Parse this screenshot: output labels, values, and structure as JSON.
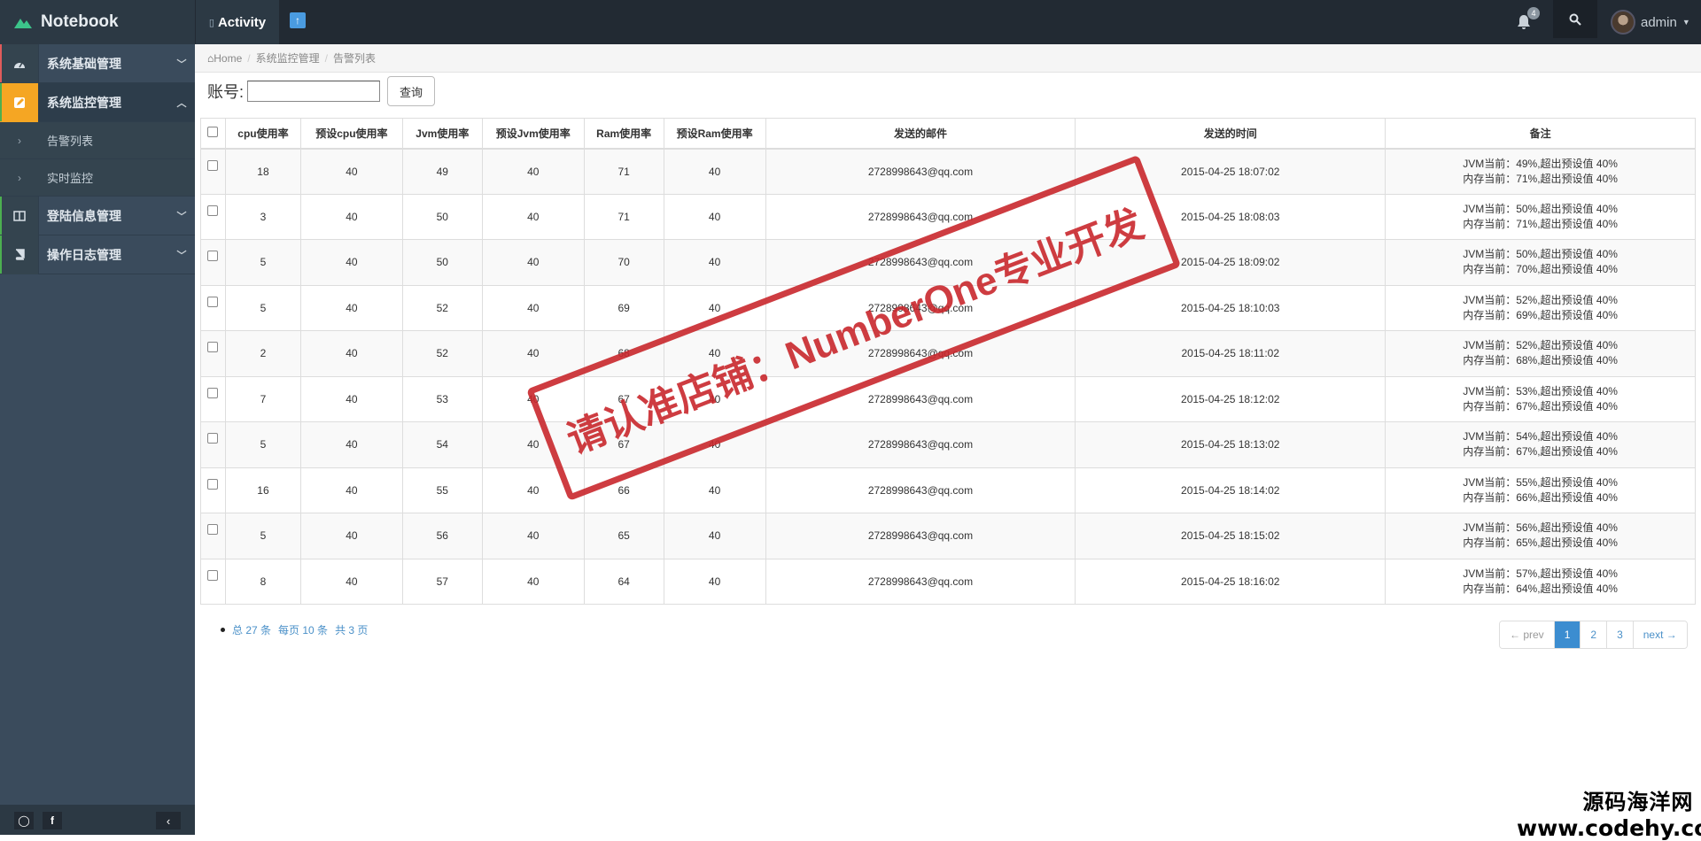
{
  "app": {
    "brand": "Notebook"
  },
  "topnav": {
    "activity_label": "Activity",
    "notification_count": "4",
    "user_name": "admin"
  },
  "sidebar": {
    "items": [
      {
        "label": "系统基础管理",
        "icon": "dashboard-icon"
      },
      {
        "label": "系统监控管理",
        "icon": "edit-icon"
      },
      {
        "label": "告警列表"
      },
      {
        "label": "实时监控"
      },
      {
        "label": "登陆信息管理",
        "icon": "columns-icon"
      },
      {
        "label": "操作日志管理",
        "icon": "book-icon"
      }
    ]
  },
  "breadcrumb": {
    "home": "Home",
    "section": "系统监控管理",
    "page": "告警列表"
  },
  "search": {
    "label": "账号:",
    "value": "",
    "button": "查询"
  },
  "table": {
    "columns": [
      "cpu使用率",
      "预设cpu使用率",
      "Jvm使用率",
      "预设Jvm使用率",
      "Ram使用率",
      "预设Ram使用率",
      "发送的邮件",
      "发送的时间",
      "备注"
    ],
    "rows": [
      {
        "cpu": "18",
        "cpu_set": "40",
        "jvm": "49",
        "jvm_set": "40",
        "ram": "71",
        "ram_set": "40",
        "email": "2728998643@qq.com",
        "time": "2015-04-25 18:07:02",
        "note1": "JVM当前：49%,超出预设值 40%",
        "note2": "内存当前：71%,超出预设值 40%"
      },
      {
        "cpu": "3",
        "cpu_set": "40",
        "jvm": "50",
        "jvm_set": "40",
        "ram": "71",
        "ram_set": "40",
        "email": "2728998643@qq.com",
        "time": "2015-04-25 18:08:03",
        "note1": "JVM当前：50%,超出预设值 40%",
        "note2": "内存当前：71%,超出预设值 40%"
      },
      {
        "cpu": "5",
        "cpu_set": "40",
        "jvm": "50",
        "jvm_set": "40",
        "ram": "70",
        "ram_set": "40",
        "email": "2728998643@qq.com",
        "time": "2015-04-25 18:09:02",
        "note1": "JVM当前：50%,超出预设值 40%",
        "note2": "内存当前：70%,超出预设值 40%"
      },
      {
        "cpu": "5",
        "cpu_set": "40",
        "jvm": "52",
        "jvm_set": "40",
        "ram": "69",
        "ram_set": "40",
        "email": "2728998643@qq.com",
        "time": "2015-04-25 18:10:03",
        "note1": "JVM当前：52%,超出预设值 40%",
        "note2": "内存当前：69%,超出预设值 40%"
      },
      {
        "cpu": "2",
        "cpu_set": "40",
        "jvm": "52",
        "jvm_set": "40",
        "ram": "68",
        "ram_set": "40",
        "email": "2728998643@qq.com",
        "time": "2015-04-25 18:11:02",
        "note1": "JVM当前：52%,超出预设值 40%",
        "note2": "内存当前：68%,超出预设值 40%"
      },
      {
        "cpu": "7",
        "cpu_set": "40",
        "jvm": "53",
        "jvm_set": "40",
        "ram": "67",
        "ram_set": "40",
        "email": "2728998643@qq.com",
        "time": "2015-04-25 18:12:02",
        "note1": "JVM当前：53%,超出预设值 40%",
        "note2": "内存当前：67%,超出预设值 40%"
      },
      {
        "cpu": "5",
        "cpu_set": "40",
        "jvm": "54",
        "jvm_set": "40",
        "ram": "67",
        "ram_set": "40",
        "email": "2728998643@qq.com",
        "time": "2015-04-25 18:13:02",
        "note1": "JVM当前：54%,超出预设值 40%",
        "note2": "内存当前：67%,超出预设值 40%"
      },
      {
        "cpu": "16",
        "cpu_set": "40",
        "jvm": "55",
        "jvm_set": "40",
        "ram": "66",
        "ram_set": "40",
        "email": "2728998643@qq.com",
        "time": "2015-04-25 18:14:02",
        "note1": "JVM当前：55%,超出预设值 40%",
        "note2": "内存当前：66%,超出预设值 40%"
      },
      {
        "cpu": "5",
        "cpu_set": "40",
        "jvm": "56",
        "jvm_set": "40",
        "ram": "65",
        "ram_set": "40",
        "email": "2728998643@qq.com",
        "time": "2015-04-25 18:15:02",
        "note1": "JVM当前：56%,超出预设值 40%",
        "note2": "内存当前：65%,超出预设值 40%"
      },
      {
        "cpu": "8",
        "cpu_set": "40",
        "jvm": "57",
        "jvm_set": "40",
        "ram": "64",
        "ram_set": "40",
        "email": "2728998643@qq.com",
        "time": "2015-04-25 18:16:02",
        "note1": "JVM当前：57%,超出预设值 40%",
        "note2": "内存当前：64%,超出预设值 40%"
      }
    ]
  },
  "summary": {
    "total": "总 27 条",
    "per_page": "每页 10 条",
    "pages": "共 3 页"
  },
  "pagination": {
    "prev": "← prev",
    "pages": [
      "1",
      "2",
      "3"
    ],
    "current": "1",
    "next": "next →"
  },
  "overlay": {
    "stamp_text": "请认准店铺：NumberOne专业开发",
    "watermark_line1": "源码海洋网",
    "watermark_line2": "www.codehy.com"
  },
  "colors": {
    "topbar": "#222a33",
    "sidebar": "#3a4b5c",
    "active_icon": "#f5a623",
    "alert_red": "#e00000",
    "pager_active": "#3c8dd0",
    "stamp_red": "#c9282d"
  }
}
